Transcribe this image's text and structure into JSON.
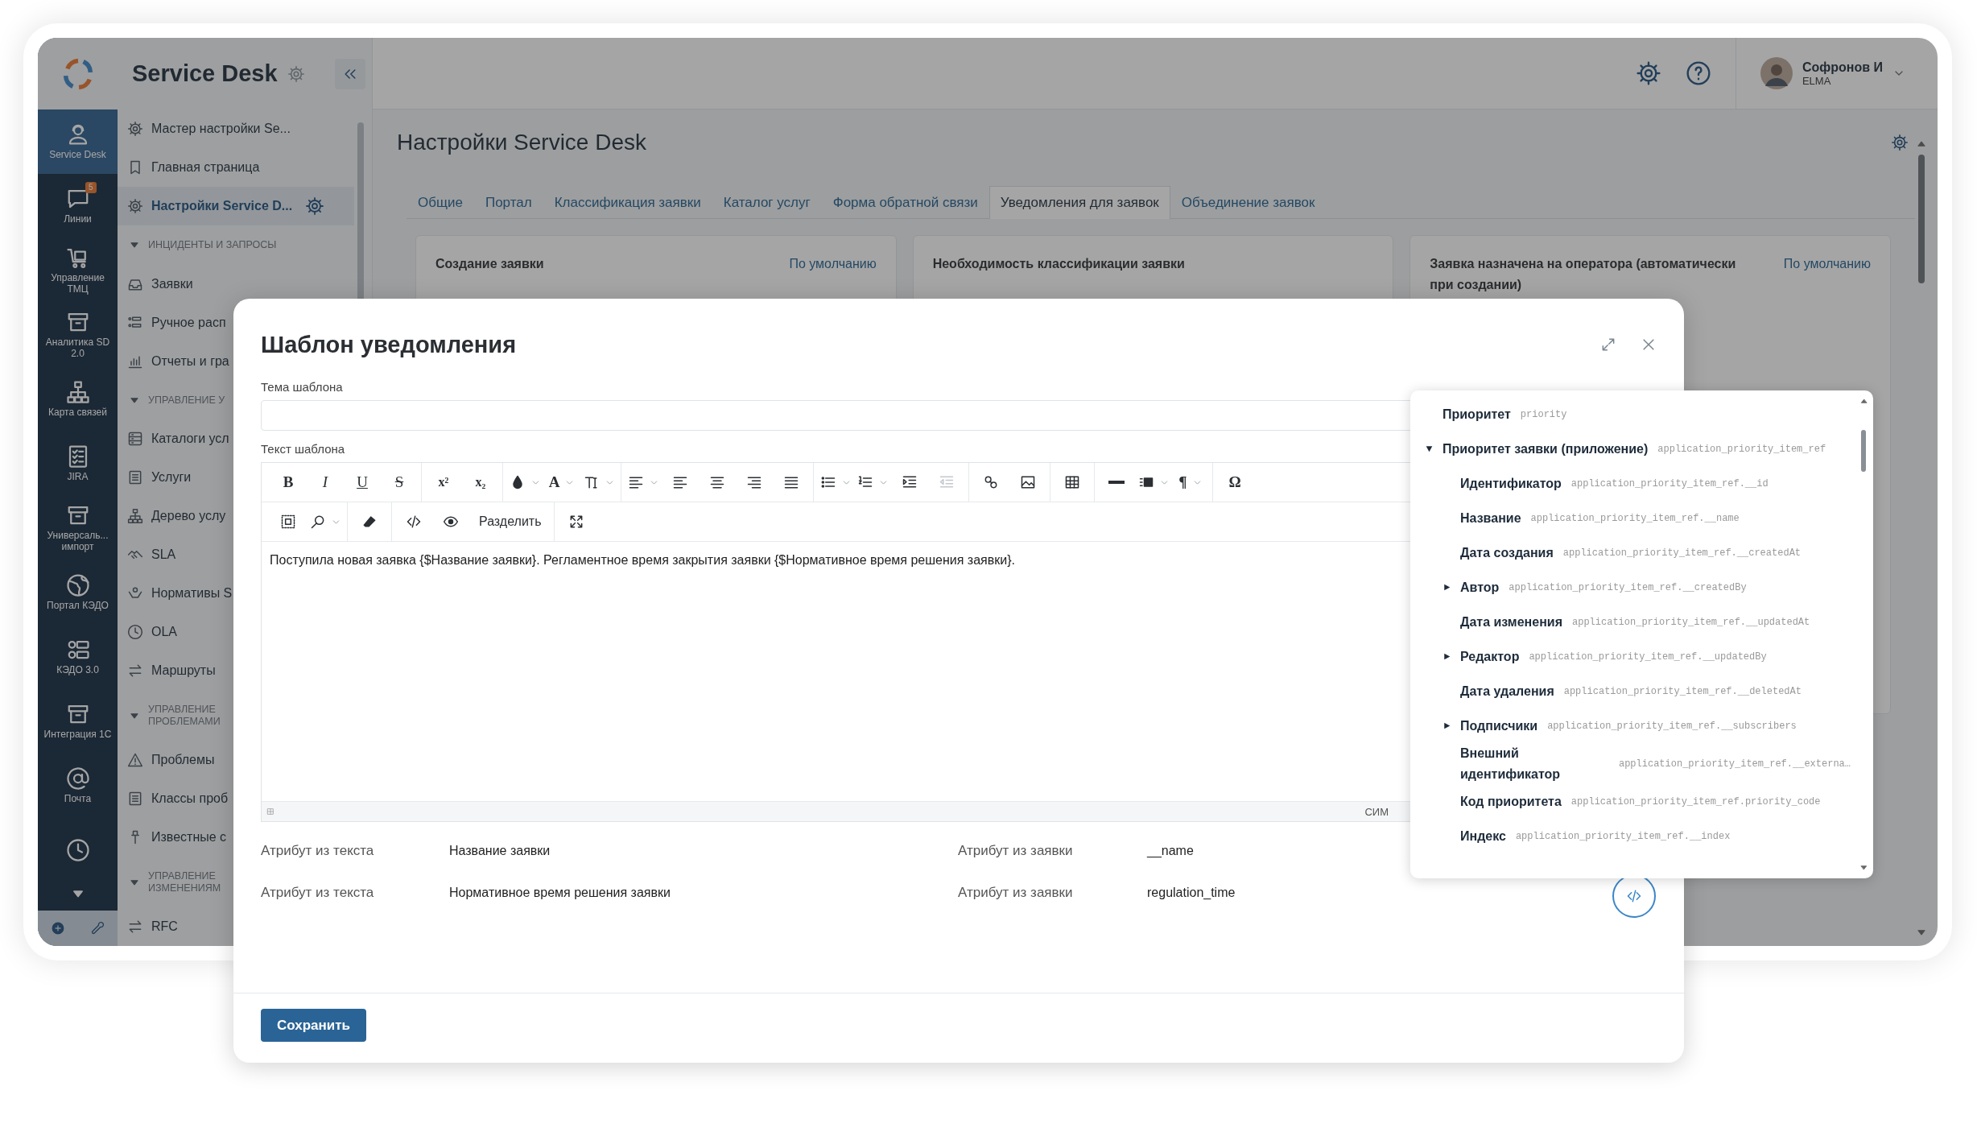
{
  "rail": {
    "items": [
      {
        "label": "Service Desk",
        "selected": true
      },
      {
        "label": "Линии",
        "selected": false,
        "badge": "5"
      },
      {
        "label": "Управление ТМЦ",
        "selected": false
      },
      {
        "label": "Аналитика SD 2.0",
        "selected": false
      },
      {
        "label": "Карта связей",
        "selected": false
      },
      {
        "label": "JIRA",
        "selected": false
      },
      {
        "label": "Универсаль... импорт",
        "selected": false
      },
      {
        "label": "Портал КЭДО",
        "selected": false
      },
      {
        "label": "КЭДО 3.0",
        "selected": false
      },
      {
        "label": "Интеграция 1С",
        "selected": false
      },
      {
        "label": "Почта",
        "selected": false
      },
      {
        "selected": false
      }
    ]
  },
  "sidebar": {
    "title": "Service Desk",
    "items": [
      {
        "kind": "link",
        "label": "Мастер настройки Se...",
        "selected": false
      },
      {
        "kind": "link",
        "label": "Главная страница",
        "selected": false
      },
      {
        "kind": "link",
        "label": "Настройки Service D...",
        "selected": true
      },
      {
        "kind": "section",
        "label": "ИНЦИДЕНТЫ И ЗАПРОСЫ",
        "expanded": true
      },
      {
        "kind": "link",
        "label": "Заявки",
        "selected": false
      },
      {
        "kind": "link",
        "label": "Ручное расп",
        "selected": false
      },
      {
        "kind": "link",
        "label": "Отчеты и гра",
        "selected": false
      },
      {
        "kind": "section",
        "label": "УПРАВЛЕНИЕ У",
        "expanded": true
      },
      {
        "kind": "link",
        "label": "Каталоги усл",
        "selected": false
      },
      {
        "kind": "link",
        "label": "Услуги",
        "selected": false
      },
      {
        "kind": "link",
        "label": "Дерево услу",
        "selected": false
      },
      {
        "kind": "link",
        "label": "SLA",
        "selected": false
      },
      {
        "kind": "link",
        "label": "Нормативы S",
        "selected": false
      },
      {
        "kind": "link",
        "label": "OLA",
        "selected": false
      },
      {
        "kind": "link",
        "label": "Маршруты",
        "selected": false
      },
      {
        "kind": "section",
        "label": "УПРАВЛЕНИЕ ПРОБЛЕМАМИ",
        "expanded": true
      },
      {
        "kind": "link",
        "label": "Проблемы",
        "selected": false
      },
      {
        "kind": "link",
        "label": "Классы проб",
        "selected": false
      },
      {
        "kind": "link",
        "label": "Известные с",
        "selected": false
      },
      {
        "kind": "section",
        "label": "УПРАВЛЕНИЕ ИЗМЕНЕНИЯМ",
        "expanded": true
      },
      {
        "kind": "link",
        "label": "RFC",
        "selected": false
      }
    ]
  },
  "header": {
    "user": {
      "name": "Софронов И",
      "org": "ELMA"
    }
  },
  "page": {
    "title": "Настройки Service Desk",
    "tabs": [
      {
        "label": "Общие",
        "selected": false
      },
      {
        "label": "Портал",
        "selected": false
      },
      {
        "label": "Классификация заявки",
        "selected": false
      },
      {
        "label": "Каталог услуг",
        "selected": false
      },
      {
        "label": "Форма обратной связи",
        "selected": false
      },
      {
        "label": "Уведомления для заявок",
        "selected": true
      },
      {
        "label": "Объединение заявок",
        "selected": false
      }
    ],
    "cards": [
      {
        "title": "Создание заявки",
        "action": "По умолчанию"
      },
      {
        "title": "Необходимость классификации заявки"
      },
      {
        "title": "Заявка назначена на оператора (автоматически при создании)",
        "action": "По умолчанию"
      }
    ]
  },
  "modal": {
    "title": "Шаблон уведомления",
    "subject": {
      "label": "Тема шаблона"
    },
    "body": {
      "label": "Текст шаблона",
      "toolbar": [
        [
          [
            {
              "kind": "glyph",
              "text": "B",
              "dropdown": false,
              "disabled": false
            },
            {
              "kind": "glyph",
              "text": "I",
              "dropdown": false,
              "disabled": false
            },
            {
              "kind": "glyph",
              "text": "U",
              "dropdown": false,
              "disabled": false
            },
            {
              "kind": "glyph",
              "text": "S",
              "dropdown": false,
              "disabled": false
            }
          ],
          [
            {
              "kind": "glyph",
              "text": "x²",
              "dropdown": false,
              "disabled": false
            },
            {
              "kind": "glyph",
              "text": "x₂",
              "dropdown": false,
              "disabled": false
            }
          ],
          [
            {
              "kind": "icon",
              "dropdown": true,
              "disabled": false
            },
            {
              "kind": "glyph",
              "text": "A",
              "dropdown": true,
              "disabled": false
            },
            {
              "kind": "icon",
              "dropdown": true,
              "disabled": false
            }
          ],
          [
            {
              "kind": "icon",
              "dropdown": true,
              "disabled": false
            },
            {
              "kind": "icon",
              "dropdown": false,
              "disabled": false
            },
            {
              "kind": "icon",
              "dropdown": false,
              "disabled": false
            },
            {
              "kind": "icon",
              "dropdown": false,
              "disabled": false
            },
            {
              "kind": "icon",
              "dropdown": false,
              "disabled": false
            }
          ],
          [
            {
              "kind": "icon",
              "dropdown": true,
              "disabled": false
            },
            {
              "kind": "icon",
              "dropdown": true,
              "disabled": false
            },
            {
              "kind": "icon",
              "dropdown": false,
              "disabled": false
            },
            {
              "kind": "icon",
              "dropdown": false,
              "disabled": true
            }
          ],
          [
            {
              "kind": "icon",
              "dropdown": false,
              "disabled": false
            },
            {
              "kind": "icon",
              "dropdown": false,
              "disabled": false
            }
          ],
          [
            {
              "kind": "icon",
              "dropdown": false,
              "disabled": false
            }
          ],
          [
            {
              "kind": "icon",
              "dropdown": false,
              "disabled": false
            },
            {
              "kind": "icon",
              "dropdown": true,
              "disabled": false
            },
            {
              "kind": "glyph",
              "text": "¶",
              "dropdown": true,
              "disabled": false
            }
          ],
          [
            {
              "kind": "glyph",
              "text": "Ω",
              "dropdown": false,
              "disabled": false
            }
          ]
        ],
        [
          [
            {
              "kind": "icon",
              "dropdown": false,
              "disabled": false
            },
            {
              "kind": "icon",
              "dropdown": true,
              "disabled": false
            }
          ],
          [
            {
              "kind": "icon",
              "dropdown": false,
              "disabled": false
            }
          ],
          [
            {
              "kind": "icon",
              "dropdown": false,
              "disabled": false
            },
            {
              "kind": "icon",
              "dropdown": false,
              "disabled": false
            },
            {
              "kind": "text",
              "text": "Разделить",
              "dropdown": false,
              "disabled": false
            }
          ],
          [
            {
              "kind": "icon",
              "dropdown": false,
              "disabled": false
            }
          ]
        ]
      ],
      "text": "Поступила новая заявка {$Название заявки}. Регламентное время закрытия заявки {$Нормативное время решения заявки}.",
      "status": "СИМ"
    },
    "mappings": [
      {
        "text_label": "Атрибут из текста",
        "text_value": "Название заявки",
        "app_label": "Атрибут из заявки",
        "app_value": "__name"
      },
      {
        "text_label": "Атрибут из текста",
        "text_value": "Нормативное время решения заявки",
        "app_label": "Атрибут из заявки",
        "app_value": "regulation_time"
      }
    ],
    "save": "Сохранить",
    "attribute_menu": {
      "items": [
        {
          "kind": "field",
          "label": "Приоритет",
          "code": "priority"
        },
        {
          "kind": "group",
          "expanded": true,
          "label": "Приоритет заявки (приложение)",
          "code": "application_priority_item_ref",
          "children": [
            {
              "kind": "field",
              "label": "Идентификатор",
              "code": "application_priority_item_ref.__id"
            },
            {
              "kind": "field",
              "label": "Название",
              "code": "application_priority_item_ref.__name"
            },
            {
              "kind": "field",
              "label": "Дата создания",
              "code": "application_priority_item_ref.__createdAt"
            },
            {
              "kind": "group",
              "expanded": false,
              "label": "Автор",
              "code": "application_priority_item_ref.__createdBy"
            },
            {
              "kind": "field",
              "label": "Дата изменения",
              "code": "application_priority_item_ref.__updatedAt"
            },
            {
              "kind": "group",
              "expanded": false,
              "label": "Редактор",
              "code": "application_priority_item_ref.__updatedBy"
            },
            {
              "kind": "field",
              "label": "Дата удаления",
              "code": "application_priority_item_ref.__deletedAt"
            },
            {
              "kind": "group",
              "expanded": false,
              "label": "Подписчики",
              "code": "application_priority_item_ref.__subscribers"
            },
            {
              "kind": "field",
              "label": "Внешний идентификатор",
              "code": "application_priority_item_ref.__externa…"
            },
            {
              "kind": "field",
              "label": "Код приоритета",
              "code": "application_priority_item_ref.priority_code"
            },
            {
              "kind": "field",
              "label": "Индекс",
              "code": "application_priority_item_ref.__index"
            }
          ]
        }
      ]
    }
  }
}
